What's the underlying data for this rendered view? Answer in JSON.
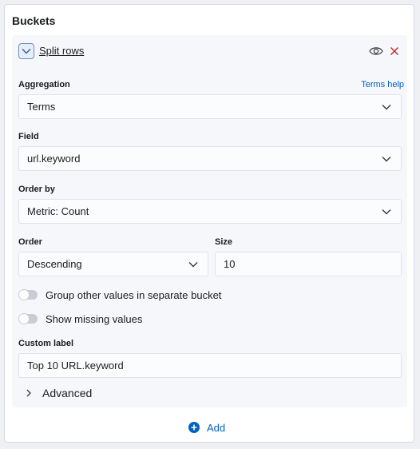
{
  "panel": {
    "title": "Buckets"
  },
  "split": {
    "label": "Split rows"
  },
  "aggregation": {
    "label": "Aggregation",
    "help": "Terms help",
    "value": "Terms"
  },
  "field": {
    "label": "Field",
    "value": "url.keyword"
  },
  "order_by": {
    "label": "Order by",
    "value": "Metric: Count"
  },
  "order": {
    "label": "Order",
    "value": "Descending"
  },
  "size": {
    "label": "Size",
    "value": "10"
  },
  "toggles": {
    "group_other": {
      "label": "Group other values in separate bucket",
      "enabled": false
    },
    "show_missing": {
      "label": "Show missing values",
      "enabled": false
    }
  },
  "custom_label": {
    "label": "Custom label",
    "value": "Top 10 URL.keyword"
  },
  "advanced": {
    "label": "Advanced"
  },
  "add": {
    "label": "Add"
  },
  "icons": {
    "collapse": "chevron-down-icon",
    "visibility": "eye-icon",
    "remove": "close-icon",
    "add": "plus-circle-icon",
    "expand": "chevron-right-icon"
  },
  "colors": {
    "link": "#0061c2",
    "remove": "#bd271e"
  }
}
